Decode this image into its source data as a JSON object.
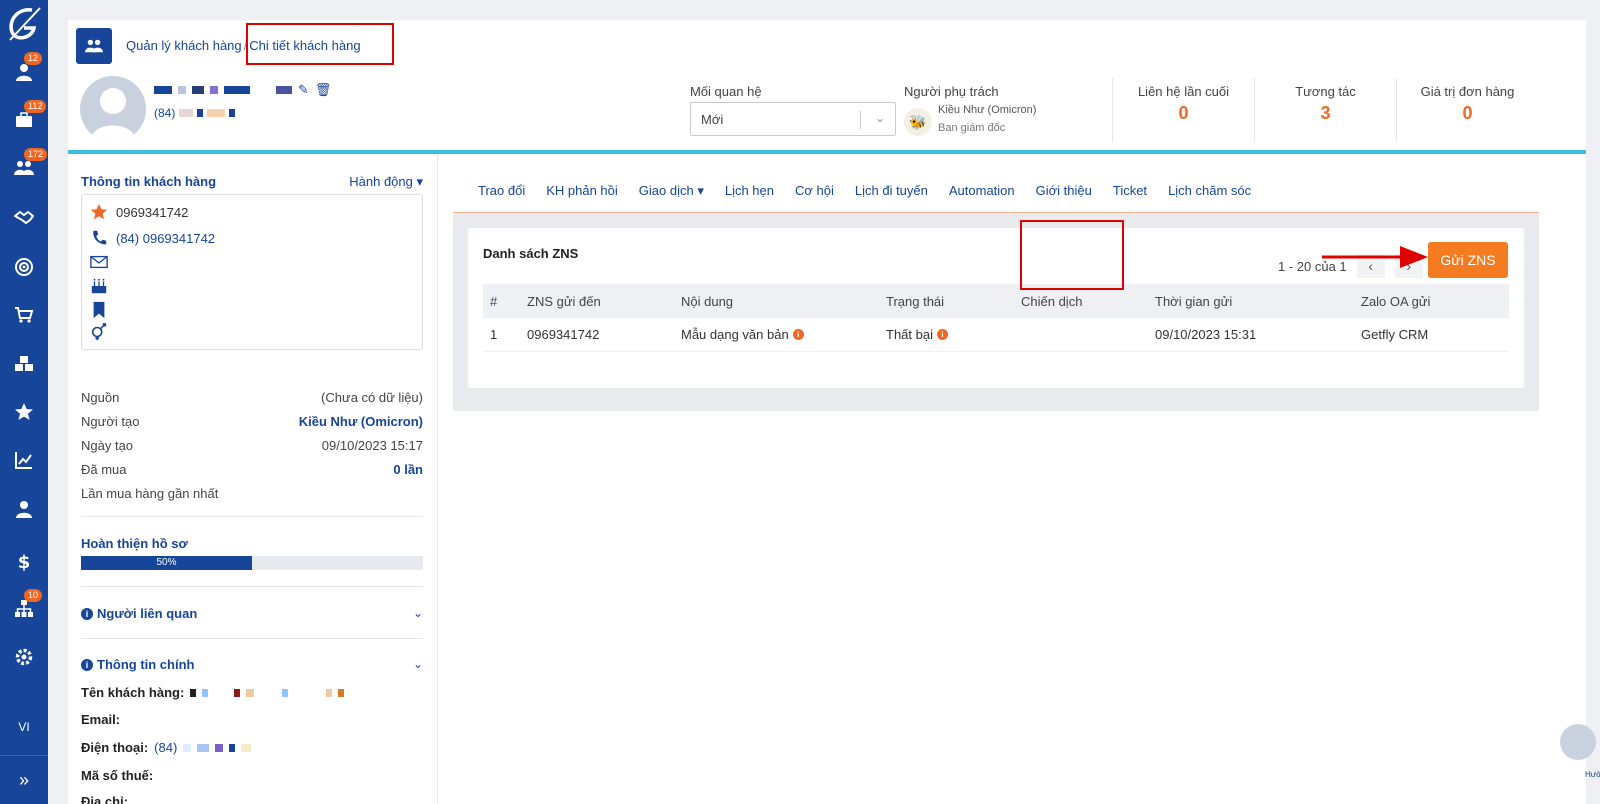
{
  "sidebar": {
    "badges": {
      "user": "12",
      "briefcase": "112",
      "group": "172",
      "org": "10"
    },
    "lang": "VI",
    "expand": "»"
  },
  "header": {
    "breadcrumb_parent": "Quản lý khách hàng",
    "breadcrumb_current": "Chi tiết khách hàng",
    "phone_prefix": "(84)",
    "relationship_label": "Mối quan hệ",
    "relationship_value": "Mới",
    "owner_label": "Người phụ trách",
    "owner_name": "Kiều Như (Omicron)",
    "owner_role": "Ban giám đốc",
    "stats": [
      {
        "label": "Liên hệ lần cuối",
        "value": "0"
      },
      {
        "label": "Tương tác",
        "value": "3"
      },
      {
        "label": "Giá trị đơn hàng",
        "value": "0"
      }
    ]
  },
  "left": {
    "title": "Thông tin khách hàng",
    "action": "Hành động ▾",
    "contact_star_phone": "0969341742",
    "contact_phone": "(84) 0969341742",
    "info": [
      {
        "label": "Nguồn",
        "value": "(Chưa có dữ liệu)"
      },
      {
        "label": "Người tạo",
        "value": "Kiều Như (Omicron)"
      },
      {
        "label": "Ngày tạo",
        "value": "09/10/2023 15:17"
      },
      {
        "label": "Đã mua",
        "value": "0 lần"
      },
      {
        "label": "Lần mua hàng gần nhất",
        "value": ""
      }
    ],
    "progress_title": "Hoàn thiện hồ sơ",
    "progress_value": 0.5,
    "progress_label": "50%",
    "related_title": "Người liên quan",
    "main_info_title": "Thông tin chính",
    "fields": {
      "name": "Tên khách hàng:",
      "email": "Email:",
      "phone": "Điện thoại:",
      "phone_prefix": "(84)",
      "tax": "Mã số thuế:",
      "address": "Địa chỉ:"
    }
  },
  "tabs": [
    "Trao đổi",
    "KH phản hồi",
    "Giao dịch ▾",
    "Lịch hẹn",
    "Cơ hội",
    "Lịch đi tuyến",
    "Automation",
    "Giới thiệu",
    "Ticket",
    "Lịch chăm sóc"
  ],
  "zns": {
    "title": "Danh sách ZNS",
    "pager": "1 - 20 của 1",
    "send_button": "Gửi ZNS",
    "columns": [
      "#",
      "ZNS gửi đến",
      "Nội dung",
      "Trạng thái",
      "Chiến dịch",
      "Thời gian gửi",
      "Zalo OA gửi"
    ],
    "rows": [
      [
        "1",
        "0969341742",
        "Mẫu dạng văn bản",
        "Thất bại",
        "",
        "09/10/2023 15:31",
        "Getfly CRM"
      ]
    ]
  },
  "help": "Hướ",
  "colors": {
    "primary": "#16459a",
    "accent": "#f26522",
    "highlight": "#e10000",
    "cyan": "#3dbfd9"
  }
}
